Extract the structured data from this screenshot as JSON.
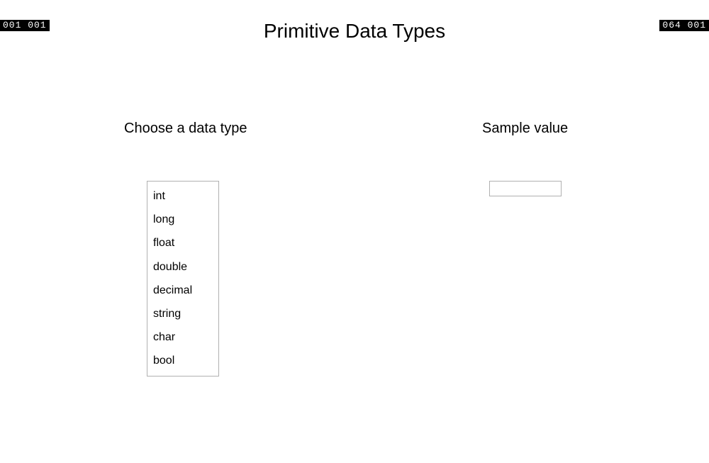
{
  "corners": {
    "top_left": "001  001",
    "top_right": "064  001"
  },
  "title": "Primitive Data Types",
  "left": {
    "label": "Choose a data type",
    "items": [
      "int",
      "long",
      "float",
      "double",
      "decimal",
      "string",
      "char",
      "bool"
    ]
  },
  "right": {
    "label": "Sample value",
    "value": ""
  }
}
